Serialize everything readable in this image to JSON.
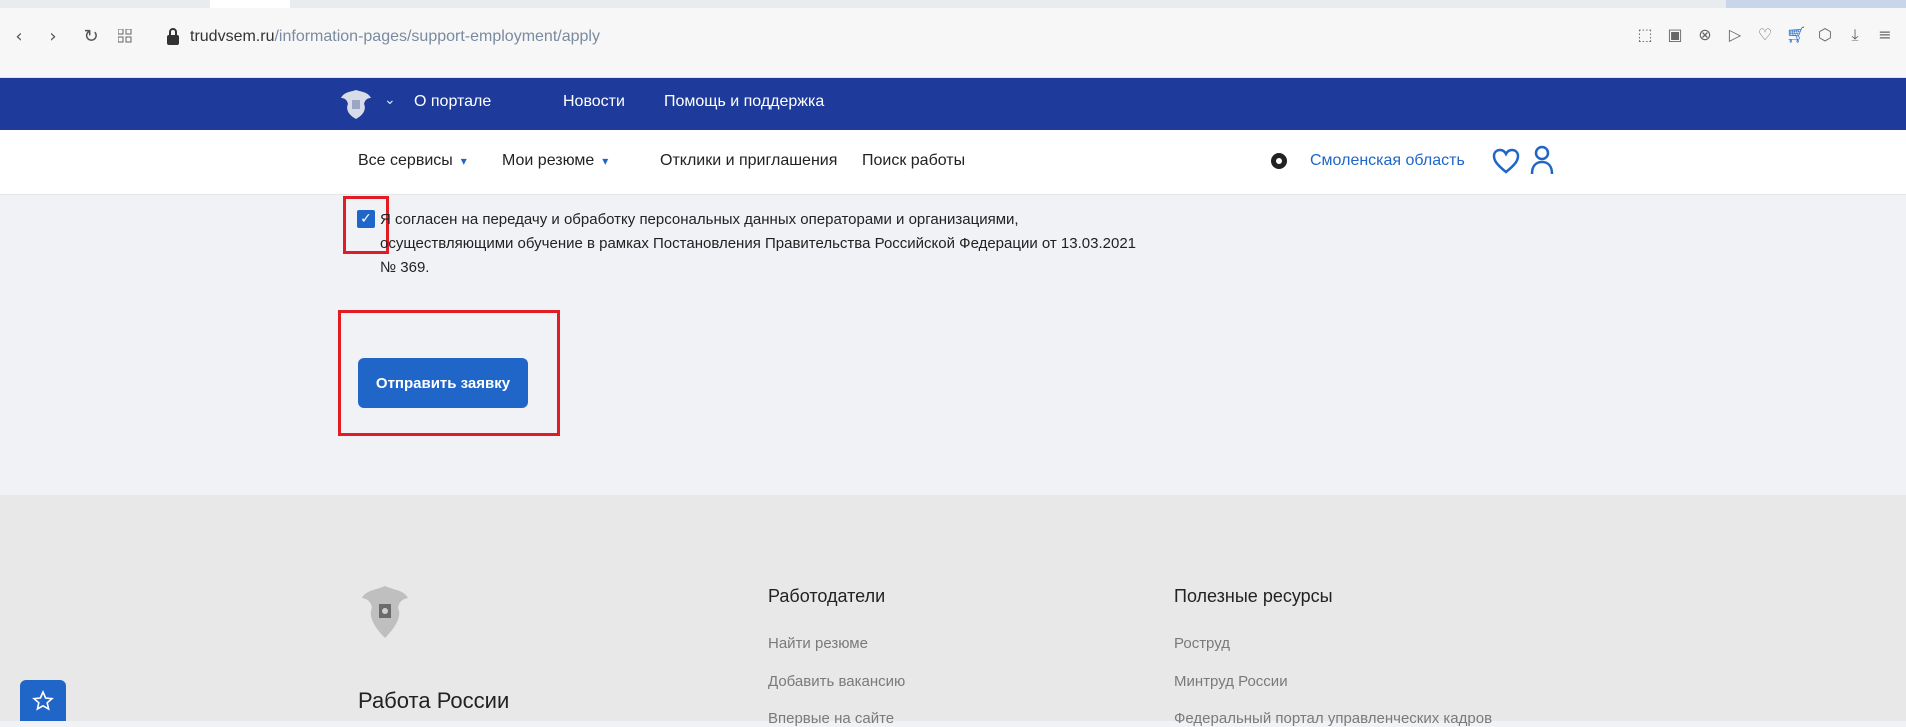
{
  "browser": {
    "url_host": "trudvsem.ru",
    "url_path": "/information-pages/support-employment/apply",
    "nav_icons": [
      "back-icon",
      "forward-icon",
      "reload-icon",
      "apps-icon"
    ],
    "ext_icons": [
      "screenshot-icon",
      "camera-icon",
      "shield-icon",
      "play-icon",
      "heart-icon",
      "cart-icon",
      "cube-icon",
      "download-icon",
      "menu-icon"
    ]
  },
  "top_header": {
    "links": [
      "О портале",
      "Новости",
      "Помощь и поддержка"
    ]
  },
  "sub_nav": {
    "links": [
      {
        "label": "Все сервисы",
        "dropdown": true
      },
      {
        "label": "Мои резюме",
        "dropdown": true
      },
      {
        "label": "Отклики и приглашения",
        "dropdown": false
      },
      {
        "label": "Поиск работы",
        "dropdown": false
      }
    ],
    "region": "Смоленская область"
  },
  "form": {
    "consent_checked": true,
    "consent_text": "Я согласен на передачу и обработку персональных данных операторами и организациями, осуществляющими обучение в рамках Постановления Правительства Российской Федерации от 13.03.2021 № 369.",
    "submit_label": "Отправить заявку"
  },
  "footer": {
    "brand": "Работа России",
    "columns": [
      {
        "title": "Работодатели",
        "links": [
          "Найти резюме",
          "Добавить вакансию",
          "Впервые на сайте"
        ]
      },
      {
        "title": "Полезные ресурсы",
        "links": [
          "Роструд",
          "Минтруд России",
          "Федеральный портал управленческих кадров"
        ]
      }
    ]
  },
  "colors": {
    "header_blue": "#1e3a9a",
    "primary_blue": "#1f66c8",
    "highlight_red": "#e21c24"
  }
}
